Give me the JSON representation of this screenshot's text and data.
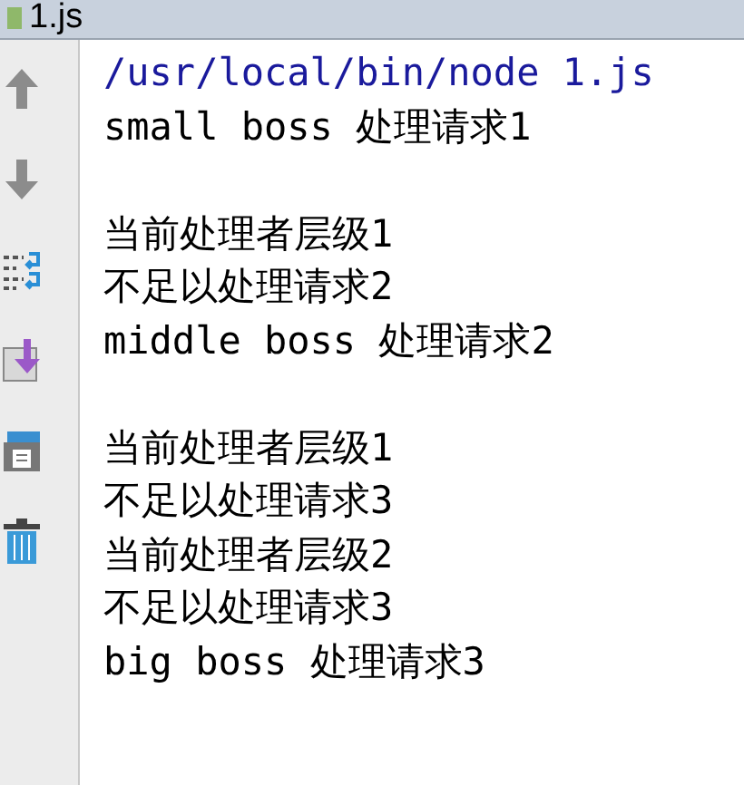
{
  "tab": {
    "label": "1.js"
  },
  "console": {
    "lines": [
      {
        "kind": "command",
        "text": "/usr/local/bin/node 1.js"
      },
      {
        "kind": "output",
        "text": "small boss 处理请求1"
      },
      {
        "kind": "blank"
      },
      {
        "kind": "output",
        "text": "当前处理者层级1"
      },
      {
        "kind": "output",
        "text": "不足以处理请求2"
      },
      {
        "kind": "output",
        "text": "middle boss 处理请求2"
      },
      {
        "kind": "blank"
      },
      {
        "kind": "output",
        "text": "当前处理者层级1"
      },
      {
        "kind": "output",
        "text": "不足以处理请求3"
      },
      {
        "kind": "output",
        "text": "当前处理者层级2"
      },
      {
        "kind": "output",
        "text": "不足以处理请求3"
      },
      {
        "kind": "output",
        "text": "big boss 处理请求3"
      }
    ]
  }
}
